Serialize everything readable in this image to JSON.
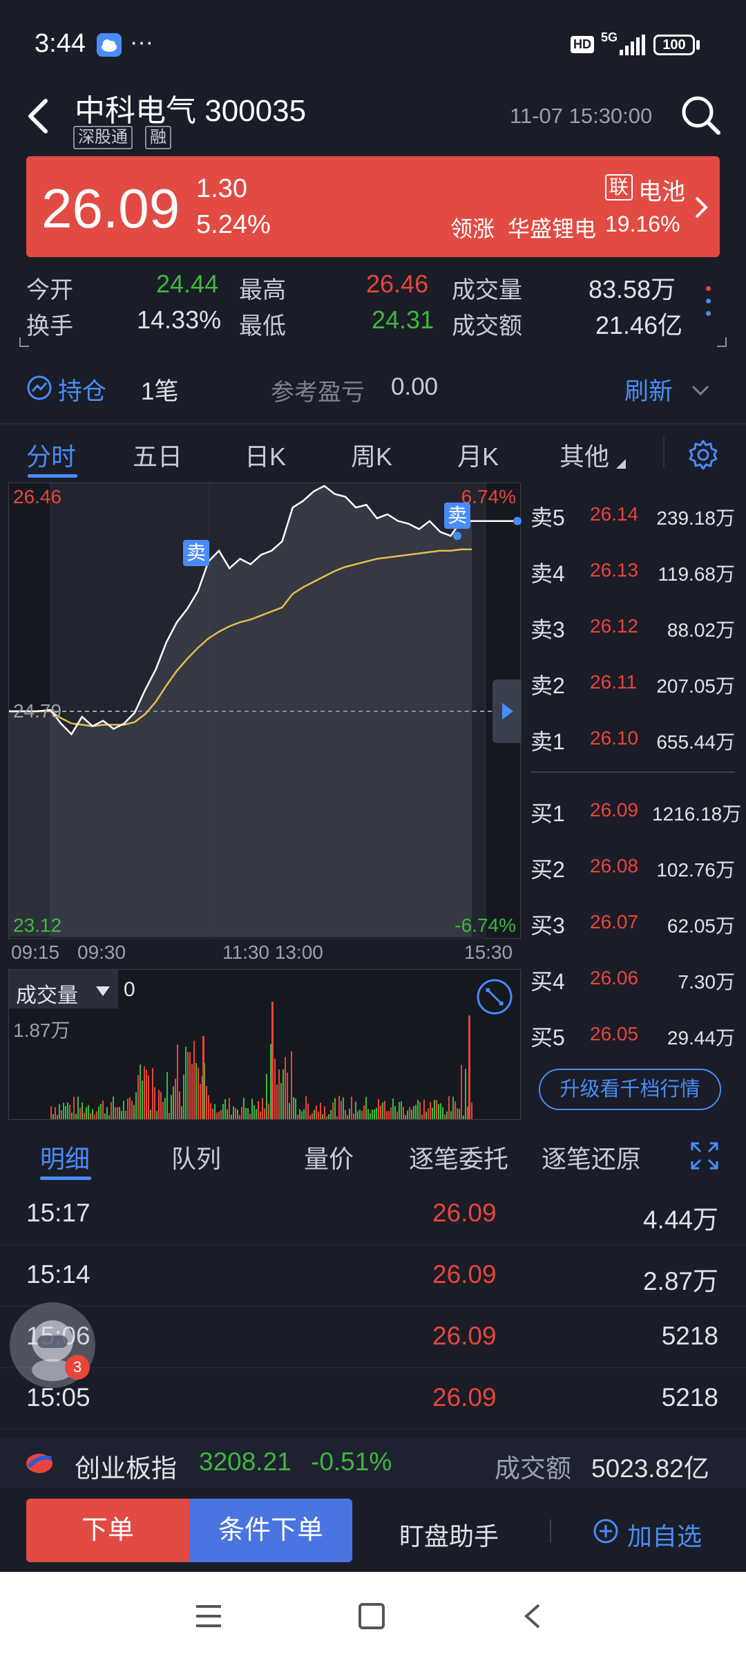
{
  "status": {
    "time": "3:44",
    "dots": "···",
    "hd": "HD",
    "net": "5G",
    "battery": "100"
  },
  "header": {
    "name": "中科电气 300035",
    "tag1": "深股通",
    "tag2": "融",
    "datetime": "11-07 15:30:00"
  },
  "banner": {
    "price": "26.09",
    "change": "1.30",
    "pct": "5.24%",
    "lian": "联",
    "sector": "电池",
    "lead_label": "领涨",
    "lead_name": "华盛锂电",
    "lead_pct": "19.16%"
  },
  "stats": [
    {
      "label": "今开",
      "value": "24.44",
      "color": "#3fb83f"
    },
    {
      "label": "最高",
      "value": "26.46",
      "color": "#e8453c"
    },
    {
      "label": "成交量",
      "value": "83.58万",
      "color": "#e0e3ea"
    },
    {
      "label": "换手",
      "value": "14.33%",
      "color": "#e0e3ea"
    },
    {
      "label": "最低",
      "value": "24.31",
      "color": "#3fb83f"
    },
    {
      "label": "成交额",
      "value": "21.46亿",
      "color": "#e0e3ea"
    }
  ],
  "position": {
    "label": "持仓",
    "count": "1笔",
    "pl_label": "参考盈亏",
    "pl_value": "0.00",
    "refresh": "刷新"
  },
  "chart_tabs": [
    "分时",
    "五日",
    "日K",
    "周K",
    "月K",
    "其他"
  ],
  "chart": {
    "ymax": "26.46",
    "ymid": "24.79",
    "ymin": "23.12",
    "pct_top": "6.74%",
    "pct_bottom": "-6.74%",
    "xticks": [
      "09:15",
      "09:30",
      "11:30 13:00",
      "15:30"
    ],
    "sell_marker": "卖",
    "volume_label": "成交量",
    "volume_value": "0",
    "volume_max": "1.87万"
  },
  "chart_data": {
    "type": "line",
    "ylim": [
      23.12,
      26.46
    ],
    "series": [
      {
        "values": [
          24.79,
          24.79,
          24.8,
          24.7,
          24.62,
          24.75,
          24.68,
          24.72,
          24.66,
          24.7,
          24.78,
          24.95,
          25.1,
          25.3,
          25.45,
          25.55,
          25.68,
          25.9,
          25.98,
          25.85,
          25.92,
          25.88,
          25.95,
          25.98,
          26.05,
          26.3,
          26.35,
          26.42,
          26.46,
          26.4,
          26.38,
          26.3,
          26.32,
          26.22,
          26.25,
          26.2,
          26.18,
          26.14,
          26.2,
          26.12,
          26.09,
          26.2,
          26.2
        ]
      },
      {
        "values": [
          24.79,
          24.79,
          24.79,
          24.74,
          24.7,
          24.69,
          24.68,
          24.69,
          24.69,
          24.69,
          24.71,
          24.77,
          24.86,
          24.98,
          25.09,
          25.18,
          25.26,
          25.33,
          25.38,
          25.42,
          25.45,
          25.47,
          25.5,
          25.53,
          25.56,
          25.66,
          25.71,
          25.75,
          25.79,
          25.83,
          25.86,
          25.88,
          25.9,
          25.92,
          25.93,
          25.94,
          25.95,
          25.96,
          25.97,
          25.98,
          25.98,
          25.99,
          25.99
        ]
      }
    ]
  },
  "orderbook": {
    "asks": [
      {
        "label": "卖5",
        "price": "26.14",
        "vol": "239.18万"
      },
      {
        "label": "卖4",
        "price": "26.13",
        "vol": "119.68万"
      },
      {
        "label": "卖3",
        "price": "26.12",
        "vol": "88.02万"
      },
      {
        "label": "卖2",
        "price": "26.11",
        "vol": "207.05万"
      },
      {
        "label": "卖1",
        "price": "26.10",
        "vol": "655.44万"
      }
    ],
    "bids": [
      {
        "label": "买1",
        "price": "26.09",
        "vol": "1216.18万"
      },
      {
        "label": "买2",
        "price": "26.08",
        "vol": "102.76万"
      },
      {
        "label": "买3",
        "price": "26.07",
        "vol": "62.05万"
      },
      {
        "label": "买4",
        "price": "26.06",
        "vol": "7.30万"
      },
      {
        "label": "买5",
        "price": "26.05",
        "vol": "29.44万"
      }
    ],
    "upgrade": "升级看千档行情"
  },
  "detail_tabs": [
    "明细",
    "队列",
    "量价",
    "逐笔委托",
    "逐笔还原"
  ],
  "trades": [
    {
      "time": "15:17",
      "price": "26.09",
      "vol": "4.44万"
    },
    {
      "time": "15:14",
      "price": "26.09",
      "vol": "2.87万"
    },
    {
      "time": "15:06",
      "price": "26.09",
      "vol": "5218"
    },
    {
      "time": "15:05",
      "price": "26.09",
      "vol": "5218"
    }
  ],
  "floating_badge": "3",
  "index": {
    "name": "创业板指",
    "value": "3208.21",
    "pct": "-0.51%",
    "amt_label": "成交额",
    "amt": "5023.82亿"
  },
  "actions": {
    "order": "下单",
    "cond": "条件下单",
    "watch": "盯盘助手",
    "add": "加自选"
  }
}
